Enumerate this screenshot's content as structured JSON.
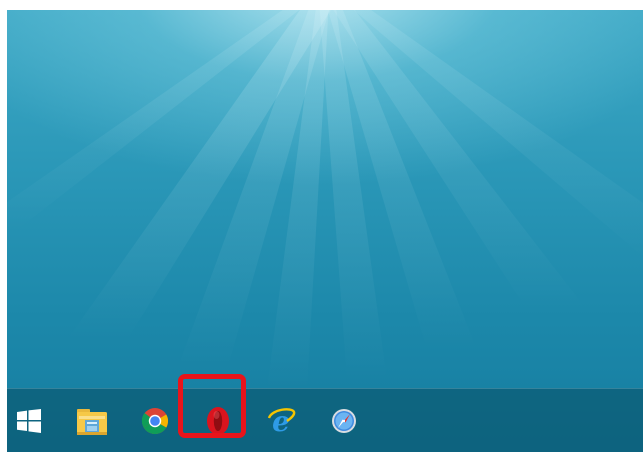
{
  "window": {
    "title": ""
  },
  "desktop": {
    "wallpaper": "underwater-light-rays"
  },
  "taskbar": {
    "items": [
      {
        "name": "start-button",
        "icon": "windows-logo-icon"
      },
      {
        "name": "file-explorer",
        "icon": "folder-icon"
      },
      {
        "name": "chrome",
        "icon": "chrome-icon"
      },
      {
        "name": "opera",
        "icon": "opera-icon",
        "highlighted": true
      },
      {
        "name": "internet-explorer",
        "icon": "ie-icon"
      },
      {
        "name": "safari",
        "icon": "safari-icon"
      }
    ]
  },
  "annotation": {
    "highlight_color": "#e8141b",
    "highlight_target": "opera"
  }
}
